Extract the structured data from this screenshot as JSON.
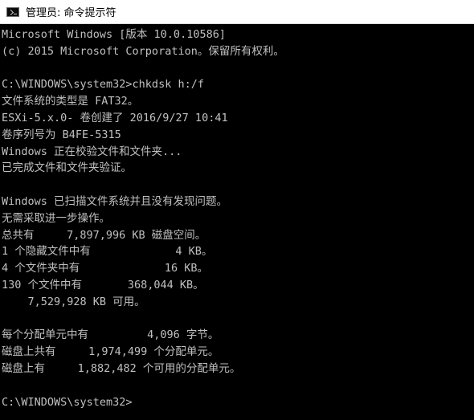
{
  "window": {
    "title": "管理员: 命令提示符",
    "icon": "command-prompt-icon"
  },
  "colors": {
    "background": "#000000",
    "text": "#c0c0c0",
    "titlebar": "#ffffff"
  },
  "console": {
    "lines": [
      "Microsoft Windows [版本 10.0.10586]",
      "(c) 2015 Microsoft Corporation。保留所有权利。",
      "",
      "C:\\WINDOWS\\system32>chkdsk h:/f",
      "文件系统的类型是 FAT32。",
      "ESXi-5.x.0- 卷创建了 2016/9/27 10:41",
      "卷序列号为 B4FE-5315",
      "Windows 正在校验文件和文件夹...",
      "已完成文件和文件夹验证。",
      "",
      "Windows 已扫描文件系统并且没有发现问题。",
      "无需采取进一步操作。",
      "总共有     7,897,996 KB 磁盘空间。",
      "1 个隐藏文件中有             4 KB。",
      "4 个文件夹中有             16 KB。",
      "130 个文件中有       368,044 KB。",
      "    7,529,928 KB 可用。",
      "",
      "每个分配单元中有         4,096 字节。",
      "磁盘上共有     1,974,499 个分配单元。",
      "磁盘上有     1,882,482 个可用的分配单元。",
      "",
      "C:\\WINDOWS\\system32>"
    ]
  }
}
